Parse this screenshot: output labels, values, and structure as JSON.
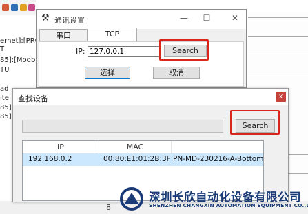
{
  "background_app": {
    "left_lines": [
      "ernet]:[PRO",
      "T",
      "85]:[Modb",
      "TU",
      "ad",
      "ite",
      "85]",
      "85]"
    ],
    "status_text": "8"
  },
  "comms_dialog": {
    "title": "通讯设置",
    "minimize_symbol": "—",
    "maximize_symbol": "☐",
    "close_symbol": "✕",
    "tabs": [
      {
        "label": "串口",
        "active": false
      },
      {
        "label": "TCP",
        "active": true
      }
    ],
    "ip_label": "IP:",
    "ip_value": "127.0.0.1",
    "search_label": "Search",
    "confirm_label": "选择",
    "cancel_label": "取消"
  },
  "find_dialog": {
    "title": "查找设备",
    "close_symbol": "x",
    "search_label": "Search",
    "progress": 0,
    "columns": [
      "IP",
      "MAC"
    ],
    "rows": [
      {
        "ip": "192.168.0.2",
        "mac": "00:80:E1:01:2B:3F",
        "name": "PN-MD-230216-A-Bottom"
      }
    ]
  },
  "watermark": {
    "company_cn": "深圳长欣自动化设备有限公司",
    "company_en": "SHENZHEN CHANGXIN AUTOMATION EQUIPMENT CO.,LTD"
  },
  "colors": {
    "highlight_box": "#d9261c",
    "selected_row": "#cce8ff",
    "brand_blue": "#1a3b78"
  }
}
